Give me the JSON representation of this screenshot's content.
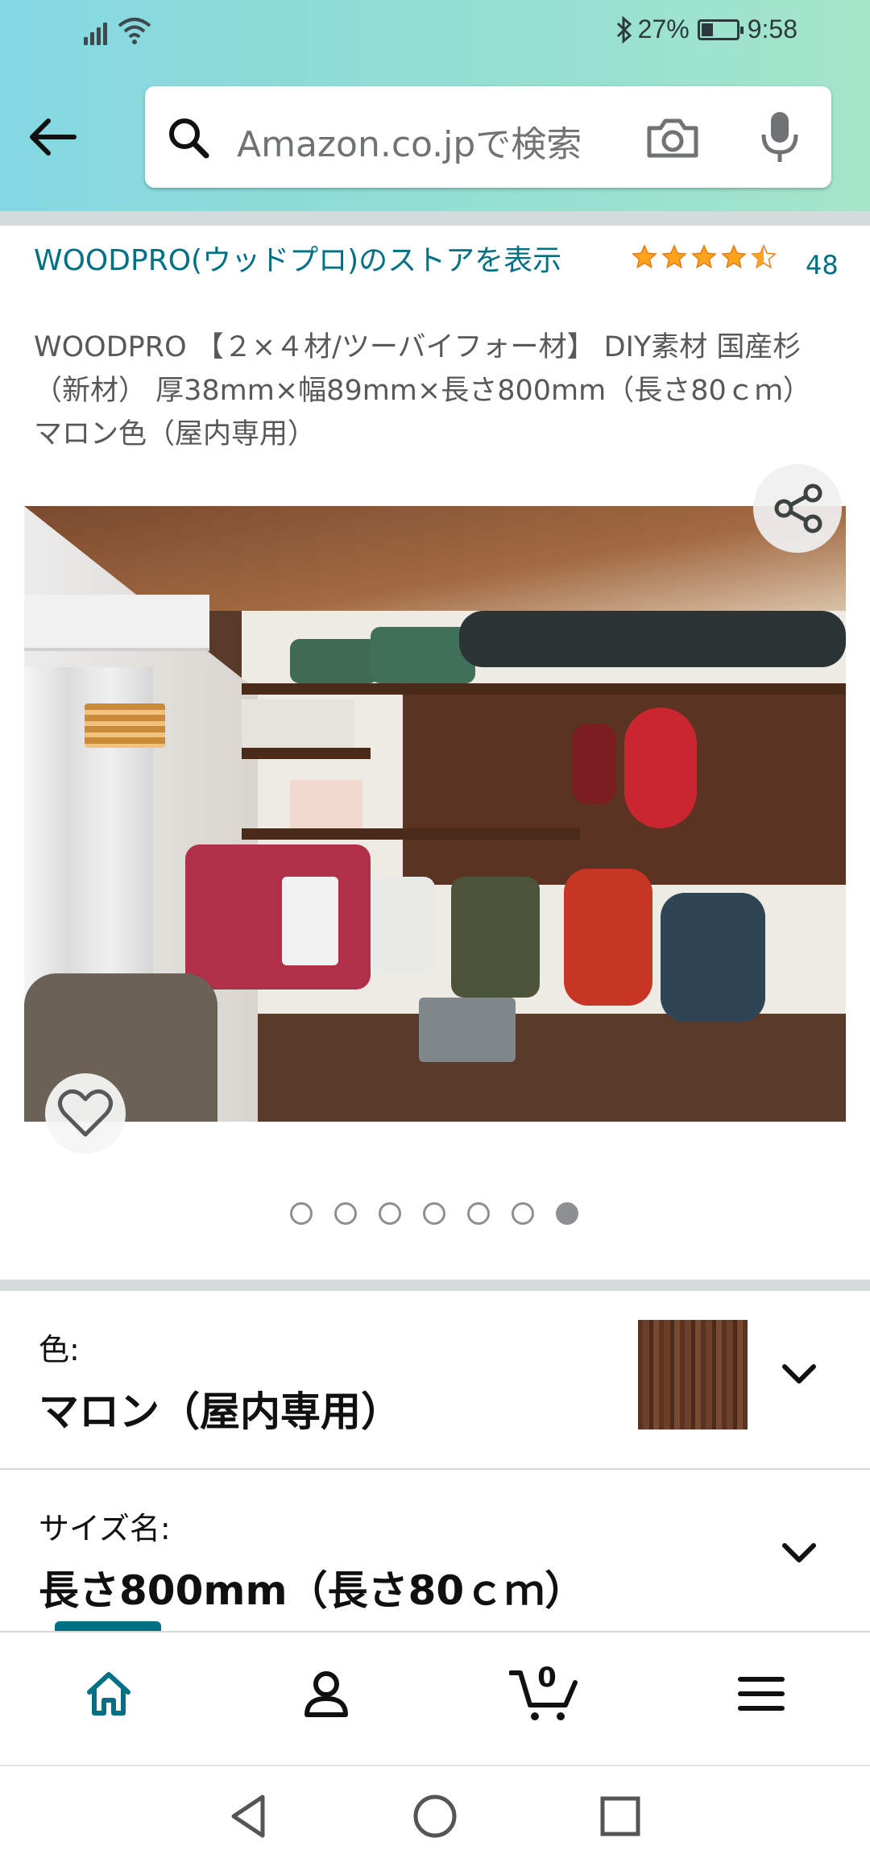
{
  "status_bar": {
    "battery": "27%",
    "time": "9:58"
  },
  "search": {
    "placeholder": "Amazon.co.jpで検索"
  },
  "product": {
    "store_link": "WOODPRO(ウッドプロ)のストアを表示",
    "rating": 4.5,
    "rating_count": "48",
    "title": "WOODPRO 【２×４材/ツーバイフォー材】 DIY素材 国産杉（新材） 厚38mm×幅89mm×長さ800mm（長さ80ｃｍ） マロン色（屋内専用）"
  },
  "carousel": {
    "image_count": 7,
    "active_index": 6
  },
  "variations": [
    {
      "label": "色:",
      "value": "マロン（屋内専用）"
    },
    {
      "label": "サイズ名:",
      "value": "長さ800mm（長さ80ｃｍ）"
    }
  ],
  "bottom_nav": {
    "cart_count": "0"
  },
  "colors": {
    "link": "#007185",
    "star": "#FFA41C",
    "text": "#0F1111"
  }
}
